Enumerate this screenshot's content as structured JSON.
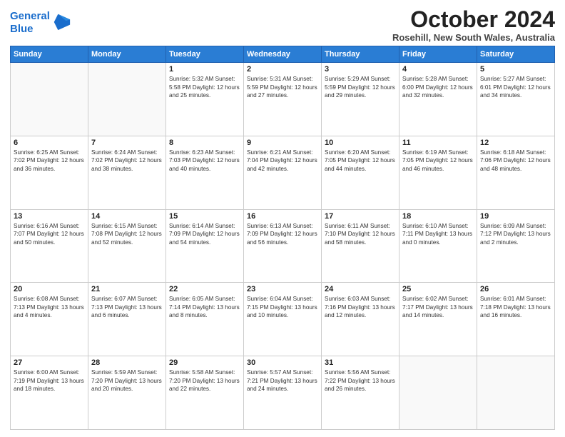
{
  "header": {
    "logo_line1": "General",
    "logo_line2": "Blue",
    "month_title": "October 2024",
    "location": "Rosehill, New South Wales, Australia"
  },
  "days_of_week": [
    "Sunday",
    "Monday",
    "Tuesday",
    "Wednesday",
    "Thursday",
    "Friday",
    "Saturday"
  ],
  "weeks": [
    [
      {
        "day": "",
        "content": ""
      },
      {
        "day": "",
        "content": ""
      },
      {
        "day": "1",
        "content": "Sunrise: 5:32 AM\nSunset: 5:58 PM\nDaylight: 12 hours\nand 25 minutes."
      },
      {
        "day": "2",
        "content": "Sunrise: 5:31 AM\nSunset: 5:59 PM\nDaylight: 12 hours\nand 27 minutes."
      },
      {
        "day": "3",
        "content": "Sunrise: 5:29 AM\nSunset: 5:59 PM\nDaylight: 12 hours\nand 29 minutes."
      },
      {
        "day": "4",
        "content": "Sunrise: 5:28 AM\nSunset: 6:00 PM\nDaylight: 12 hours\nand 32 minutes."
      },
      {
        "day": "5",
        "content": "Sunrise: 5:27 AM\nSunset: 6:01 PM\nDaylight: 12 hours\nand 34 minutes."
      }
    ],
    [
      {
        "day": "6",
        "content": "Sunrise: 6:25 AM\nSunset: 7:02 PM\nDaylight: 12 hours\nand 36 minutes."
      },
      {
        "day": "7",
        "content": "Sunrise: 6:24 AM\nSunset: 7:02 PM\nDaylight: 12 hours\nand 38 minutes."
      },
      {
        "day": "8",
        "content": "Sunrise: 6:23 AM\nSunset: 7:03 PM\nDaylight: 12 hours\nand 40 minutes."
      },
      {
        "day": "9",
        "content": "Sunrise: 6:21 AM\nSunset: 7:04 PM\nDaylight: 12 hours\nand 42 minutes."
      },
      {
        "day": "10",
        "content": "Sunrise: 6:20 AM\nSunset: 7:05 PM\nDaylight: 12 hours\nand 44 minutes."
      },
      {
        "day": "11",
        "content": "Sunrise: 6:19 AM\nSunset: 7:05 PM\nDaylight: 12 hours\nand 46 minutes."
      },
      {
        "day": "12",
        "content": "Sunrise: 6:18 AM\nSunset: 7:06 PM\nDaylight: 12 hours\nand 48 minutes."
      }
    ],
    [
      {
        "day": "13",
        "content": "Sunrise: 6:16 AM\nSunset: 7:07 PM\nDaylight: 12 hours\nand 50 minutes."
      },
      {
        "day": "14",
        "content": "Sunrise: 6:15 AM\nSunset: 7:08 PM\nDaylight: 12 hours\nand 52 minutes."
      },
      {
        "day": "15",
        "content": "Sunrise: 6:14 AM\nSunset: 7:09 PM\nDaylight: 12 hours\nand 54 minutes."
      },
      {
        "day": "16",
        "content": "Sunrise: 6:13 AM\nSunset: 7:09 PM\nDaylight: 12 hours\nand 56 minutes."
      },
      {
        "day": "17",
        "content": "Sunrise: 6:11 AM\nSunset: 7:10 PM\nDaylight: 12 hours\nand 58 minutes."
      },
      {
        "day": "18",
        "content": "Sunrise: 6:10 AM\nSunset: 7:11 PM\nDaylight: 13 hours\nand 0 minutes."
      },
      {
        "day": "19",
        "content": "Sunrise: 6:09 AM\nSunset: 7:12 PM\nDaylight: 13 hours\nand 2 minutes."
      }
    ],
    [
      {
        "day": "20",
        "content": "Sunrise: 6:08 AM\nSunset: 7:13 PM\nDaylight: 13 hours\nand 4 minutes."
      },
      {
        "day": "21",
        "content": "Sunrise: 6:07 AM\nSunset: 7:13 PM\nDaylight: 13 hours\nand 6 minutes."
      },
      {
        "day": "22",
        "content": "Sunrise: 6:05 AM\nSunset: 7:14 PM\nDaylight: 13 hours\nand 8 minutes."
      },
      {
        "day": "23",
        "content": "Sunrise: 6:04 AM\nSunset: 7:15 PM\nDaylight: 13 hours\nand 10 minutes."
      },
      {
        "day": "24",
        "content": "Sunrise: 6:03 AM\nSunset: 7:16 PM\nDaylight: 13 hours\nand 12 minutes."
      },
      {
        "day": "25",
        "content": "Sunrise: 6:02 AM\nSunset: 7:17 PM\nDaylight: 13 hours\nand 14 minutes."
      },
      {
        "day": "26",
        "content": "Sunrise: 6:01 AM\nSunset: 7:18 PM\nDaylight: 13 hours\nand 16 minutes."
      }
    ],
    [
      {
        "day": "27",
        "content": "Sunrise: 6:00 AM\nSunset: 7:19 PM\nDaylight: 13 hours\nand 18 minutes."
      },
      {
        "day": "28",
        "content": "Sunrise: 5:59 AM\nSunset: 7:20 PM\nDaylight: 13 hours\nand 20 minutes."
      },
      {
        "day": "29",
        "content": "Sunrise: 5:58 AM\nSunset: 7:20 PM\nDaylight: 13 hours\nand 22 minutes."
      },
      {
        "day": "30",
        "content": "Sunrise: 5:57 AM\nSunset: 7:21 PM\nDaylight: 13 hours\nand 24 minutes."
      },
      {
        "day": "31",
        "content": "Sunrise: 5:56 AM\nSunset: 7:22 PM\nDaylight: 13 hours\nand 26 minutes."
      },
      {
        "day": "",
        "content": ""
      },
      {
        "day": "",
        "content": ""
      }
    ]
  ]
}
